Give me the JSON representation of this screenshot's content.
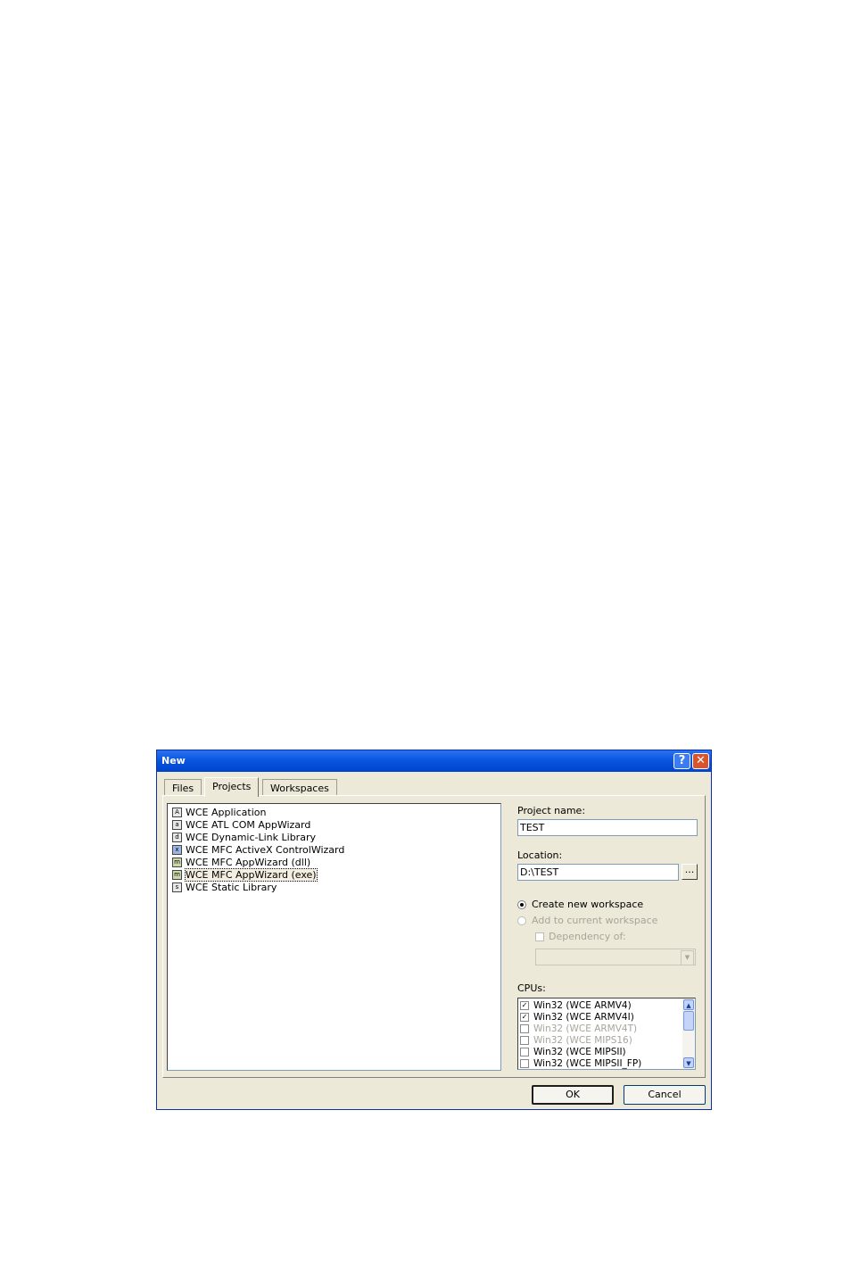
{
  "dialog": {
    "title": "New",
    "help_glyph": "?",
    "close_glyph": "✕",
    "tabs": [
      {
        "label": "Files",
        "selected": false
      },
      {
        "label": "Projects",
        "selected": true
      },
      {
        "label": "Workspaces",
        "selected": false
      }
    ],
    "project_types": [
      {
        "label": "WCE Application",
        "icon": "app-icon"
      },
      {
        "label": "WCE ATL COM AppWizard",
        "icon": "atl-icon"
      },
      {
        "label": "WCE Dynamic-Link Library",
        "icon": "dll-icon"
      },
      {
        "label": "WCE MFC ActiveX ControlWizard",
        "icon": "activex-icon"
      },
      {
        "label": "WCE MFC AppWizard (dll)",
        "icon": "mfc-dll-icon"
      },
      {
        "label": "WCE MFC AppWizard (exe)",
        "icon": "mfc-exe-icon",
        "selected": true
      },
      {
        "label": "WCE Static Library",
        "icon": "lib-icon"
      }
    ],
    "project_name": {
      "label": "Project name:",
      "value": "TEST"
    },
    "location": {
      "label": "Location:",
      "value": "D:\\TEST",
      "browse_label": "..."
    },
    "workspace": {
      "create_new": {
        "label": "Create new workspace",
        "checked": true,
        "enabled": true
      },
      "add_current": {
        "label": "Add to current workspace",
        "checked": false,
        "enabled": false
      },
      "dependency": {
        "label": "Dependency of:",
        "checked": false,
        "enabled": false
      },
      "dependency_value": ""
    },
    "cpus": {
      "label": "CPUs:",
      "items": [
        {
          "label": "Win32 (WCE ARMV4)",
          "checked": true,
          "enabled": true
        },
        {
          "label": "Win32 (WCE ARMV4I)",
          "checked": true,
          "enabled": true
        },
        {
          "label": "Win32 (WCE ARMV4T)",
          "checked": false,
          "enabled": false
        },
        {
          "label": "Win32 (WCE MIPS16)",
          "checked": false,
          "enabled": false
        },
        {
          "label": "Win32 (WCE MIPSII)",
          "checked": false,
          "enabled": true
        },
        {
          "label": "Win32 (WCE MIPSII_FP)",
          "checked": false,
          "enabled": true
        }
      ]
    },
    "ok_label": "OK",
    "cancel_label": "Cancel"
  }
}
